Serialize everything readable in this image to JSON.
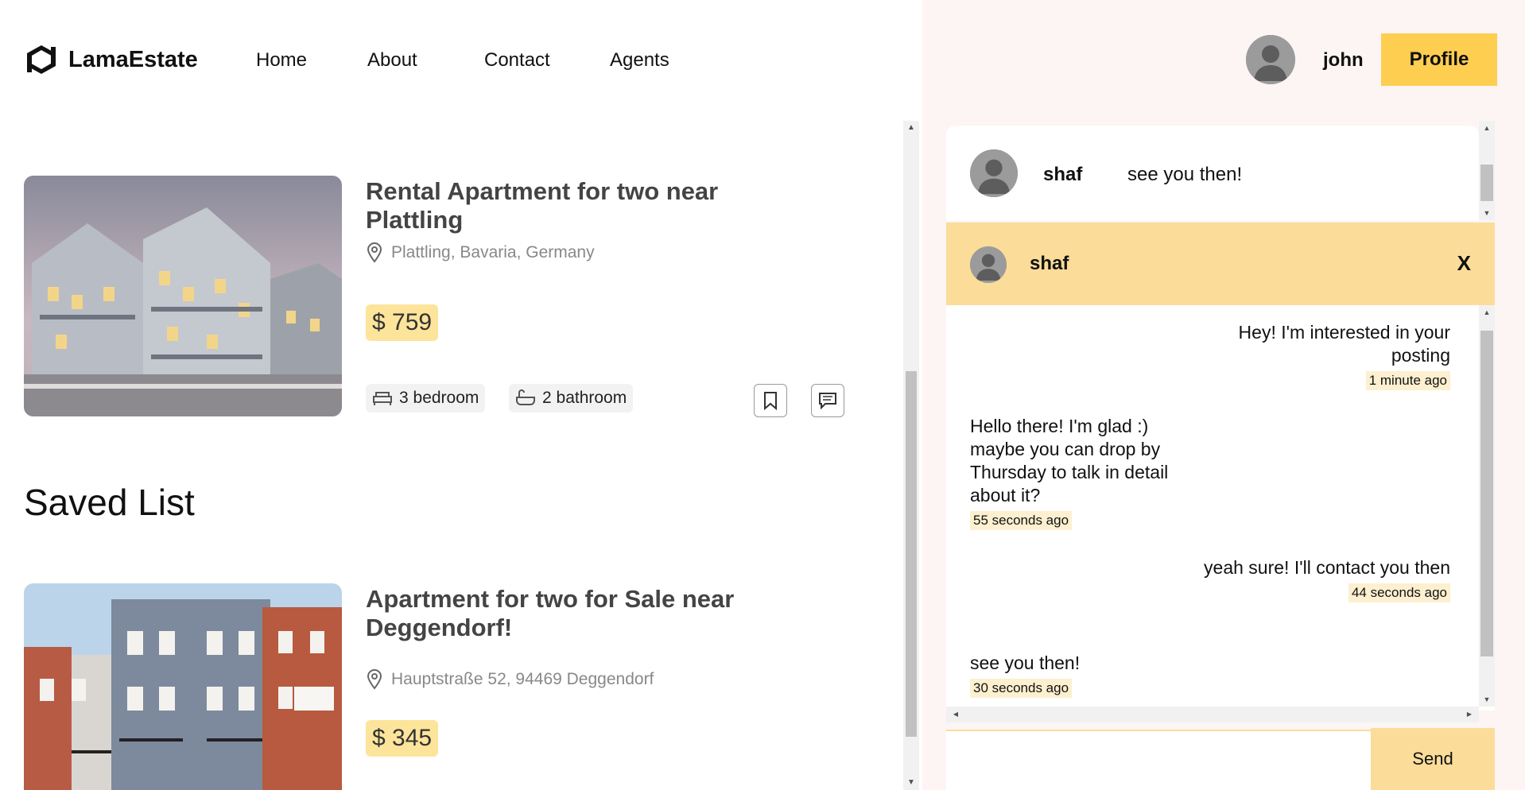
{
  "brand": {
    "name": "LamaEstate"
  },
  "nav": {
    "links": [
      "Home",
      "About",
      "Contact",
      "Agents"
    ]
  },
  "user": {
    "name": "john",
    "profile_label": "Profile"
  },
  "listings": [
    {
      "title": "Rental Apartment for two near Plattling",
      "address": "Plattling, Bavaria, Germany",
      "price": "$ 759",
      "bedroom": "3 bedroom",
      "bathroom": "2 bathroom"
    },
    {
      "title": "Apartment for two for Sale near Deggendorf!",
      "address": "Hauptstraße 52, 94469 Deggendorf",
      "price": "$ 345"
    }
  ],
  "saved_list_title": "Saved List",
  "conversation": {
    "sender": "shaf",
    "last_message": "see you then!"
  },
  "chat": {
    "with": "shaf",
    "close_label": "X",
    "messages": [
      {
        "text": "Hey! I'm interested in your posting",
        "time": "1 minute ago",
        "own": true
      },
      {
        "text": "Hello there! I'm glad :) maybe you can drop by Thursday to talk in detail about it?",
        "time": "55 seconds ago",
        "own": false
      },
      {
        "text": "yeah sure! I'll contact you then",
        "time": "44 seconds ago",
        "own": true
      },
      {
        "text": "see you then!",
        "time": "30 seconds ago",
        "own": false
      }
    ],
    "send_label": "Send",
    "input_value": ""
  },
  "icons": {
    "logo": "logo-icon",
    "pin": "map-pin-icon",
    "bed": "bed-icon",
    "bath": "bath-icon",
    "save": "bookmark-icon",
    "chat": "chat-icon"
  }
}
